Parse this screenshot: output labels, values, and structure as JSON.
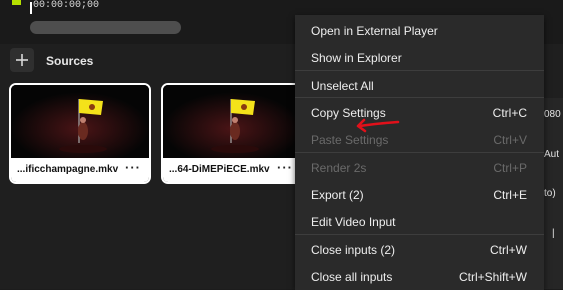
{
  "timeline": {
    "timecode": "00:00:00;00"
  },
  "sources": {
    "title": "Sources",
    "add_symbol": "+",
    "items": [
      {
        "name": "...ificchampagne.mkv",
        "more": "···"
      },
      {
        "name": "...64-DiMEPiECE.mkv",
        "more": "···"
      }
    ]
  },
  "right_panel": {
    "values": [
      "080",
      "Aut",
      "to)",
      "|"
    ]
  },
  "context_menu": {
    "items": [
      {
        "label": "Open in External Player",
        "shortcut": "",
        "enabled": true
      },
      {
        "label": "Show in Explorer",
        "shortcut": "",
        "enabled": true
      },
      {
        "label": "Unselect All",
        "shortcut": "",
        "enabled": true
      },
      {
        "label": "Copy Settings",
        "shortcut": "Ctrl+C",
        "enabled": true
      },
      {
        "label": "Paste Settings",
        "shortcut": "Ctrl+V",
        "enabled": false
      },
      {
        "label": "Render 2s",
        "shortcut": "Ctrl+P",
        "enabled": false
      },
      {
        "label": "Export (2)",
        "shortcut": "Ctrl+E",
        "enabled": true
      },
      {
        "label": "Edit Video Input",
        "shortcut": "",
        "enabled": true
      },
      {
        "label": "Close inputs (2)",
        "shortcut": "Ctrl+W",
        "enabled": true
      },
      {
        "label": "Close all inputs",
        "shortcut": "Ctrl+Shift+W",
        "enabled": true
      }
    ]
  },
  "colors": {
    "accent_green": "#b4e000",
    "annotation_arrow": "#e0101a",
    "flag_yellow": "#f4e21a"
  }
}
